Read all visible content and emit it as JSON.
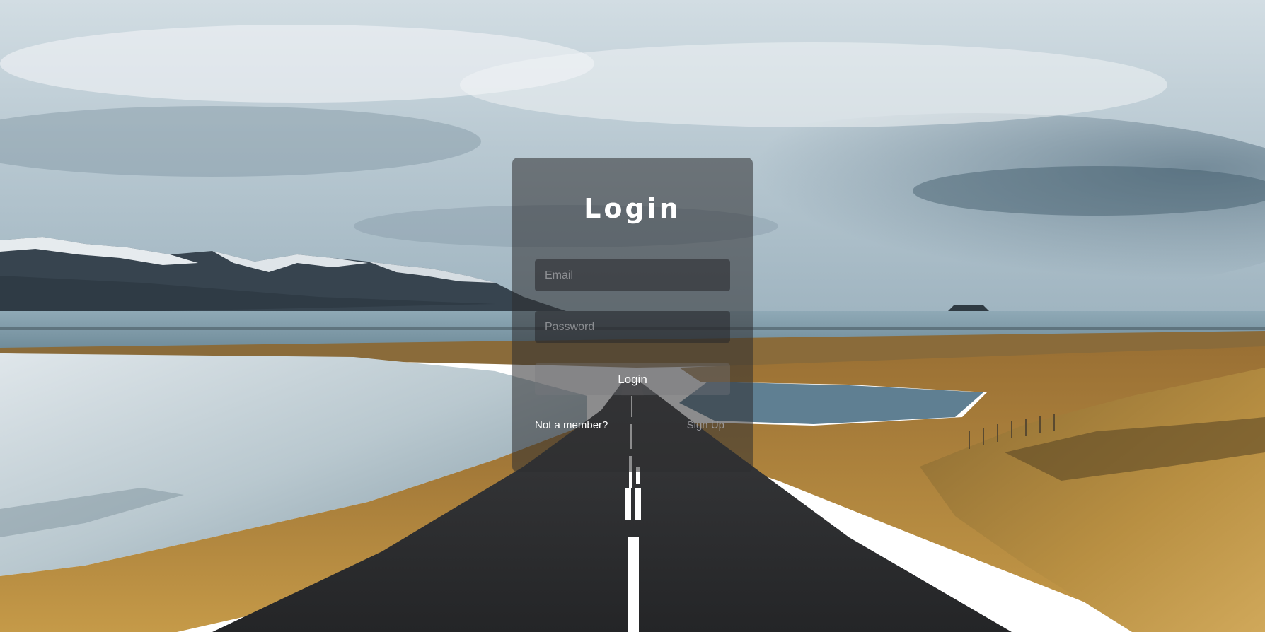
{
  "background": {
    "scene": "iceland-road-landscape",
    "colors": {
      "sky": "#c9d6dd",
      "cloud_dark": "#7f95a3",
      "mountain": "#36434f",
      "snow": "#e8edf0",
      "sea": "#9db4c1",
      "grass": "#b48a3c",
      "road": "#2b2c2e",
      "lane_marking": "#ffffff"
    }
  },
  "login_card": {
    "title": "Login",
    "email": {
      "placeholder": "Email",
      "value": ""
    },
    "password": {
      "placeholder": "Password",
      "value": ""
    },
    "submit_label": "Login",
    "footer": {
      "prompt": "Not a member?",
      "signup_label": "Sign Up"
    }
  }
}
